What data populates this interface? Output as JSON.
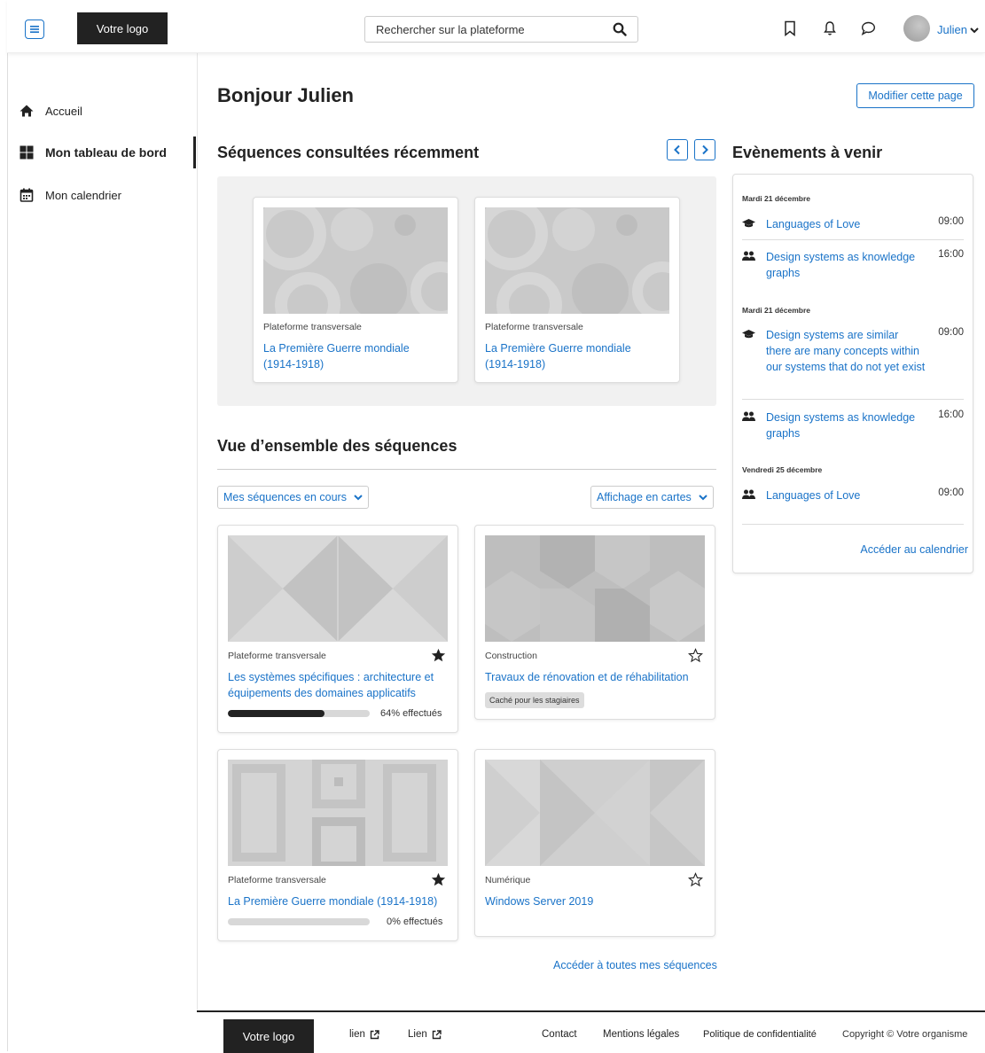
{
  "header": {
    "logo": "Votre logo",
    "search_placeholder": "Rechercher sur la plateforme",
    "user_name": "Julien"
  },
  "sidebar": {
    "items": [
      {
        "label": "Accueil",
        "icon": "home-icon"
      },
      {
        "label": "Mon tableau de bord",
        "icon": "dashboard-icon",
        "active": true
      },
      {
        "label": "Mon calendrier",
        "icon": "calendar-icon"
      }
    ]
  },
  "main": {
    "greeting": "Bonjour Julien",
    "edit_button": "Modifier cette page",
    "recent": {
      "title": "Séquences consultées récemment",
      "cards": [
        {
          "category": "Plateforme transversale",
          "title": "La Première Guerre mondiale (1914-1918)"
        },
        {
          "category": "Plateforme transversale",
          "title": "La Première Guerre mondiale (1914-1918)"
        }
      ]
    },
    "overview": {
      "title": "Vue d’ensemble des séquences",
      "filter": "Mes séquences en cours",
      "view": "Affichage en cartes",
      "cards": [
        {
          "category": "Plateforme transversale",
          "title": "Les systèmes spécifiques : architecture et équipements des domaines applicatifs",
          "starred": true,
          "progress": 64,
          "progress_label": "64% effectués"
        },
        {
          "category": "Construction",
          "title": "Travaux de rénovation et de réhabilitation",
          "starred": false,
          "badge": "Caché pour les stagiaires"
        },
        {
          "category": "Plateforme transversale",
          "title": "La Première Guerre mondiale (1914-1918)",
          "starred": true,
          "progress": 0,
          "progress_label": "0% effectués"
        },
        {
          "category": "Numérique",
          "title": "Windows Server 2019",
          "starred": false
        }
      ],
      "all_link": "Accéder à toutes mes séquences"
    }
  },
  "events": {
    "title": "Evènements à venir",
    "groups": [
      {
        "date": "Mardi 21 décembre",
        "items": [
          {
            "title": "Languages of Love",
            "time": "09:00",
            "icon": "graduation-cap-icon"
          },
          {
            "title": "Design systems as knowledge graphs",
            "time": "16:00",
            "icon": "users-icon"
          }
        ]
      },
      {
        "date": "Mardi 21 décembre",
        "items": [
          {
            "title": "Design systems are similar there are many concepts within our systems that do not yet exist",
            "time": "09:00",
            "icon": "graduation-cap-icon"
          },
          {
            "title": "Design systems as knowledge graphs",
            "time": "16:00",
            "icon": "users-icon"
          }
        ]
      },
      {
        "date": "Vendredi 25 décembre",
        "items": [
          {
            "title": "Languages of Love",
            "time": "09:00",
            "icon": "users-icon"
          }
        ]
      }
    ],
    "calendar_link": "Accéder au calendrier"
  },
  "footer": {
    "logo": "Votre logo",
    "links": [
      "lien",
      "Lien"
    ],
    "contact": "Contact",
    "legal": "Mentions légales",
    "privacy": "Politique de confidentialité",
    "copyright": "Copyright © Votre organisme"
  },
  "colors": {
    "accent": "#1a73c8",
    "dark": "#222222"
  }
}
